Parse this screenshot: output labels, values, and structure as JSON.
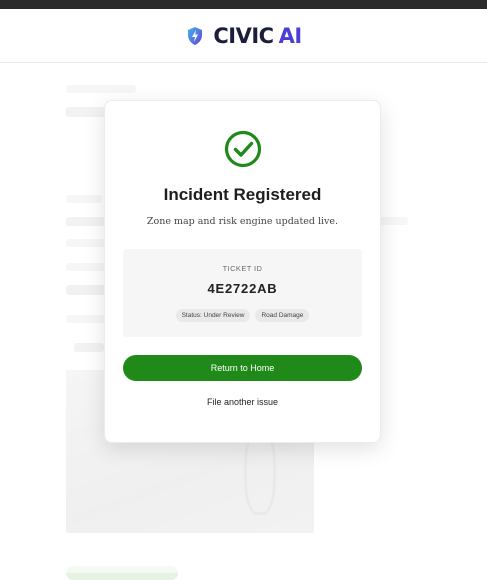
{
  "header": {
    "brand_name": "CIVIC",
    "brand_suffix": "AI",
    "logo_icon": "shield-lightning-icon"
  },
  "modal": {
    "status_icon": "check-circle-icon",
    "title": "Incident Registered",
    "subtitle": "Zone map and risk engine updated live.",
    "ticket_label": "TICKET ID",
    "ticket_id": "4E2722AB",
    "badges": [
      "Status: Under Review",
      "Road Damage"
    ],
    "primary_button": "Return to Home",
    "secondary_link": "File another issue"
  },
  "colors": {
    "accent_green": "#1f8a1a",
    "brand_dark": "#1c1d3a",
    "brand_ai": "#4b3fd6"
  }
}
